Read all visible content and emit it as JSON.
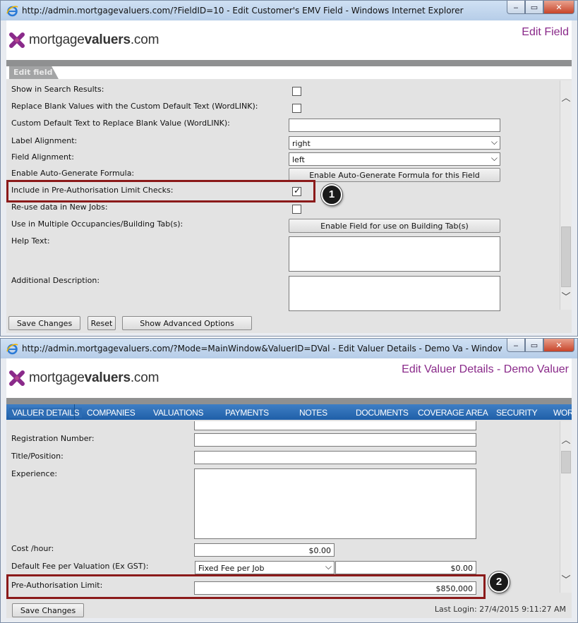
{
  "window1": {
    "title": "http://admin.mortgagevaluers.com/?FieldID=10 - Edit Customer's EMV Field - Windows Internet Explorer",
    "logo_plain": "mortgage",
    "logo_bold": "valuers",
    "logo_suffix": ".com",
    "page_title": "Edit Field",
    "tab_label": "Edit field",
    "rows": {
      "show_in_search": "Show in Search Results:",
      "replace_blank": "Replace Blank Values with the Custom Default Text (WordLINK):",
      "custom_default": "Custom Default Text to Replace Blank Value (WordLINK):",
      "label_alignment": "Label Alignment:",
      "field_alignment": "Field Alignment:",
      "auto_generate": "Enable Auto-Generate Formula:",
      "pre_auth": "Include in Pre-Authorisation Limit Checks:",
      "reuse_data": "Re-use data in New Jobs:",
      "multiple_occupancies": "Use in Multiple Occupancies/Building Tab(s):",
      "help_text": "Help Text:",
      "additional_description": "Additional Description:"
    },
    "values": {
      "custom_default": "",
      "label_alignment": "right",
      "field_alignment": "left",
      "help_text": "",
      "additional_description": ""
    },
    "checkboxes": {
      "show_in_search": false,
      "replace_blank": false,
      "pre_auth": true,
      "reuse_data": false
    },
    "buttons": {
      "auto_generate": "Enable Auto-Generate Formula for this Field",
      "building_tab": "Enable Field for use on Building Tab(s)",
      "save": "Save Changes",
      "reset": "Reset",
      "advanced": "Show Advanced Options"
    },
    "callout": "1"
  },
  "window2": {
    "title": "http://admin.mortgagevaluers.com/?Mode=MainWindow&ValuerID=DVal - Edit Valuer Details - Demo Va - Windows Internet...",
    "logo_plain": "mortgage",
    "logo_bold": "valuers",
    "logo_suffix": ".com",
    "page_title": "Edit Valuer Details - Demo Valuer",
    "nav": [
      "VALUER DETAILS",
      "COMPANIES",
      "VALUATIONS",
      "PAYMENTS",
      "NOTES",
      "DOCUMENTS",
      "COVERAGE AREA",
      "SECURITY",
      "WOR"
    ],
    "rows": {
      "registration": "Registration Number:",
      "title_position": "Title/Position:",
      "experience": "Experience:",
      "cost_hour": "Cost /hour:",
      "default_fee": "Default Fee per Valuation (Ex GST):",
      "pre_auth_limit": "Pre-Authorisation Limit:"
    },
    "values": {
      "registration": "",
      "title_position": "",
      "experience": "",
      "cost_hour": "$0.00",
      "fee_type": "Fixed Fee per Job",
      "fee_amount": "$0.00",
      "pre_auth_limit": "$850,000"
    },
    "buttons": {
      "save": "Save Changes"
    },
    "last_login": "Last Login: 27/4/2015 9:11:27 AM",
    "callout": "2"
  },
  "colors": {
    "brand_purple": "#8a2a8a",
    "nav_blue": "#1f5fa8",
    "highlight_red": "#8b1a1a"
  },
  "icons": [
    "ie-icon",
    "logo-mark-icon",
    "minimize-icon",
    "maximize-icon",
    "close-icon",
    "chevron-down-icon",
    "scroll-up-icon",
    "scroll-down-icon",
    "checkmark-icon"
  ]
}
